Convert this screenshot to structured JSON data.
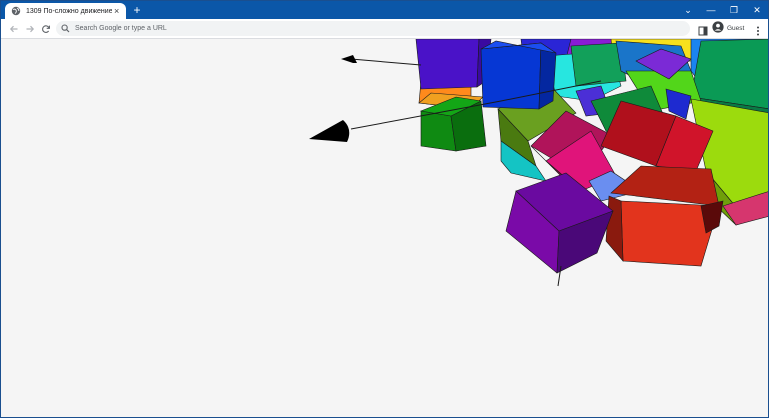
{
  "browser": {
    "tab": {
      "title": "1309 По-сложно движение.htm",
      "favicon": "globe-icon",
      "close_glyph": "×"
    },
    "new_tab_glyph": "+",
    "window_controls": {
      "dropdown": "⌄",
      "minimize": "—",
      "restore": "❐",
      "close": "✕"
    },
    "toolbar": {
      "back_icon": "back-arrow-icon",
      "forward_icon": "forward-arrow-icon",
      "reload_icon": "reload-icon",
      "address_placeholder": "Search Google or type a URL",
      "profile_label": "Guest"
    }
  },
  "colors": {
    "tabstrip": "#0b57a8",
    "page_background": "#f5f5f5",
    "cube_purple": "#7a0aa8",
    "cube_red": "#e2341d",
    "cube_green": "#0f8a12",
    "cube_blue": "#0637d4",
    "cube_magenta": "#e0147a",
    "cube_lime": "#9cdb0d"
  }
}
